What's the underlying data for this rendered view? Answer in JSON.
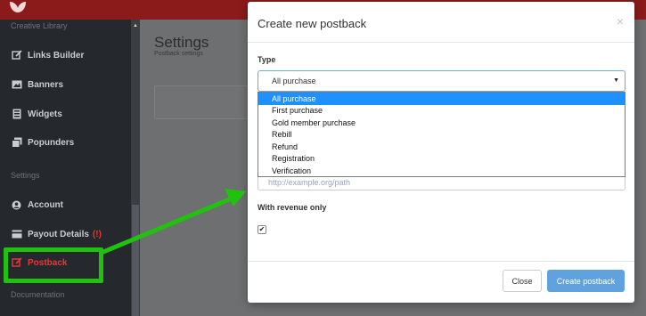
{
  "sidebar": {
    "section_creative": "Creative Library",
    "items": [
      {
        "label": "Links Builder",
        "icon": "edit-icon"
      },
      {
        "label": "Banners",
        "icon": "image-icon"
      },
      {
        "label": "Widgets",
        "icon": "widget-icon"
      },
      {
        "label": "Popunders",
        "icon": "popunder-icon"
      }
    ],
    "section_settings": "Settings",
    "account_label": "Account",
    "payout_label": "Payout Details",
    "payout_warning": "(!)",
    "postback_label": "Postback",
    "section_documentation": "Documentation"
  },
  "page": {
    "title": "Settings",
    "subtitle": "Postback settings"
  },
  "modal": {
    "title": "Create new postback",
    "close_glyph": "×",
    "type_label": "Type",
    "type_selected": "All purchase",
    "type_options": [
      "All purchase",
      "First purchase",
      "Gold member purchase",
      "Rebill",
      "Refund",
      "Registration",
      "Verification"
    ],
    "url_placeholder": "http://example.org/path",
    "revenue_label": "With revenue only",
    "revenue_checked": true,
    "close_button": "Close",
    "create_button": "Create postback"
  },
  "colors": {
    "topbar": "#8b1a1a",
    "sidebar": "#25282c",
    "active": "#e53935",
    "highlight": "#20c20e",
    "primary_button": "#5fa2dd",
    "option_selected": "#1e90ff"
  }
}
